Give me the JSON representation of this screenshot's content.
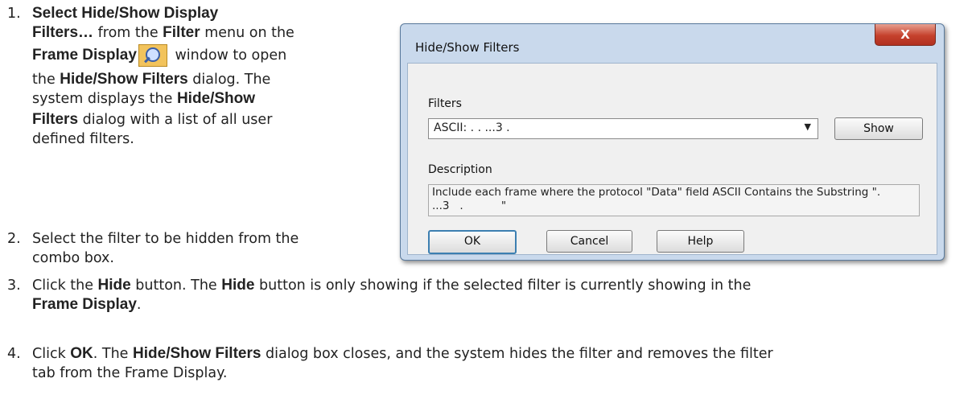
{
  "steps": [
    {
      "num": "1.",
      "lines": [
        [
          {
            "t": "Select Hide/Show Display",
            "b": true
          }
        ],
        [
          {
            "t": "Filters…",
            "b": true
          },
          {
            "t": " from the "
          },
          {
            "t": "Filter",
            "b": true
          },
          {
            "t": " menu on the"
          }
        ],
        [
          {
            "t": "Frame Display",
            "b": true
          },
          {
            "t": "ICON"
          },
          {
            "t": " window to open"
          }
        ],
        [
          {
            "t": "the "
          },
          {
            "t": "Hide/Show Filters",
            "b": true
          },
          {
            "t": " dialog. The"
          }
        ],
        [
          {
            "t": "system displays the "
          },
          {
            "t": "Hide/Show",
            "b": true
          }
        ],
        [
          {
            "t": "Filters",
            "b": true
          },
          {
            "t": " dialog with a list of all user"
          }
        ],
        [
          {
            "t": "defined filters."
          }
        ]
      ]
    },
    {
      "num": "2.",
      "lines": [
        [
          {
            "t": "Select the filter to be hidden from the"
          }
        ],
        [
          {
            "t": "combo box."
          }
        ]
      ]
    },
    {
      "num": "3.",
      "lines": [
        [
          {
            "t": "Click the "
          },
          {
            "t": "Hide",
            "b": true
          },
          {
            "t": " button. The "
          },
          {
            "t": "Hide",
            "b": true
          },
          {
            "t": " button is only showing if the selected filter is currently showing in the"
          }
        ],
        [
          {
            "t": "Frame Display",
            "b": true
          },
          {
            "t": "."
          }
        ]
      ]
    },
    {
      "num": "4.",
      "lines": [
        [
          {
            "t": "Click "
          },
          {
            "t": "OK",
            "b": true
          },
          {
            "t": ". The "
          },
          {
            "t": "Hide/Show Filters",
            "b": true
          },
          {
            "t": " dialog box closes, and the system hides the filter and removes the filter"
          }
        ],
        [
          {
            "t": "tab from the Frame Display."
          }
        ]
      ]
    }
  ],
  "icon": "frame-display-magnifier-icon",
  "dialog": {
    "title": "Hide/Show Filters",
    "close_label": "X",
    "filters_label": "Filters",
    "combo_value": "ASCII: . . ...3   .",
    "show_button": "Show",
    "description_label": "Description",
    "description_text": "Include each frame where the protocol \"Data\" field ASCII Contains the Substring \".\n...3   .           \"",
    "ok_button": "OK",
    "cancel_button": "Cancel",
    "help_button": "Help"
  }
}
